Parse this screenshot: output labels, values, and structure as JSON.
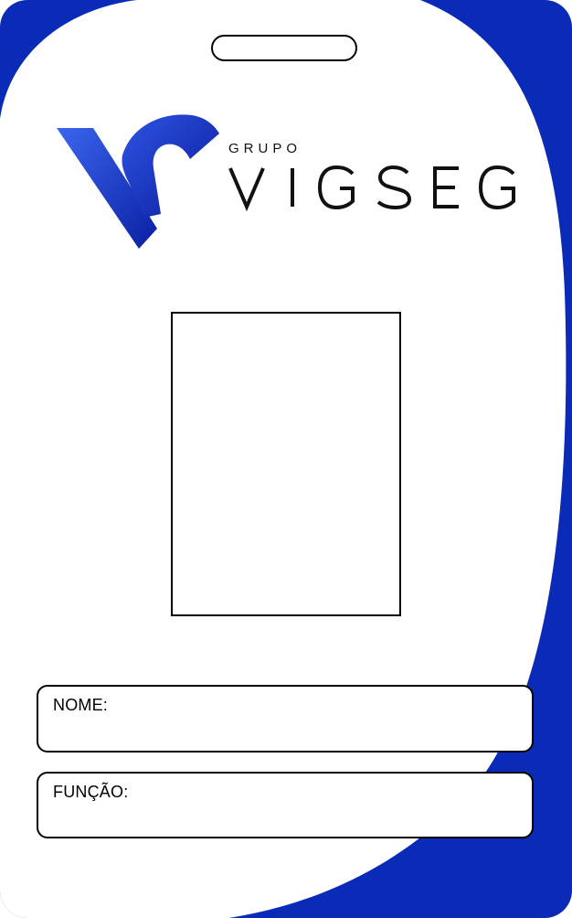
{
  "brand": {
    "group_label": "GRUPO",
    "name": "VIGSEG",
    "primary_color": "#0a2bb8",
    "gradient_light": "#2f5ce8",
    "gradient_dark": "#0a1a9a"
  },
  "photo": {
    "placeholder": ""
  },
  "fields": {
    "name_label": "NOME:",
    "role_label": "FUNÇÃO:"
  }
}
